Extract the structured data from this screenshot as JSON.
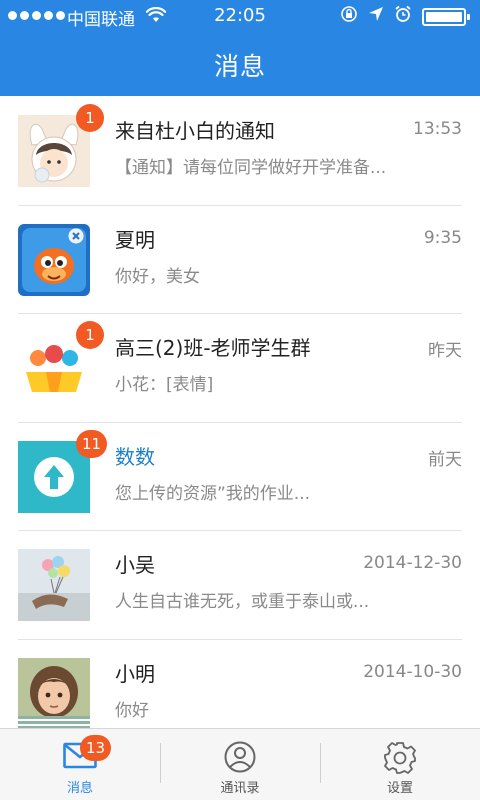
{
  "status_bar": {
    "carrier": "中国联通",
    "time": "22:05"
  },
  "header": {
    "title": "消息"
  },
  "messages": [
    {
      "name": "来自杜小白的通知",
      "time": "13:53",
      "preview": "【通知】请每位同学做好开学准备...",
      "badge": "1"
    },
    {
      "name": "夏明",
      "time": "9:35",
      "preview": "你好，美女",
      "badge": ""
    },
    {
      "name": "高三(2)班-老师学生群",
      "time": "昨天",
      "preview": "小花：[表情]",
      "badge": "1"
    },
    {
      "name": "数数",
      "time": "前天",
      "preview": "您上传的资源”我的作业...",
      "badge": "11"
    },
    {
      "name": "小吴",
      "time": "2014-12-30",
      "preview": "人生自古谁无死，或重于泰山或...",
      "badge": ""
    },
    {
      "name": "小明",
      "time": "2014-10-30",
      "preview": "你好",
      "badge": ""
    }
  ],
  "tabs": [
    {
      "label": "消息",
      "badge": "13",
      "icon": "mail-icon"
    },
    {
      "label": "通讯录",
      "badge": "",
      "icon": "contacts-icon"
    },
    {
      "label": "设置",
      "badge": "",
      "icon": "gear-icon"
    }
  ],
  "colors": {
    "header": "#2a86e3",
    "badge": "#f15a22",
    "accent_name": "#1e7fc9"
  }
}
